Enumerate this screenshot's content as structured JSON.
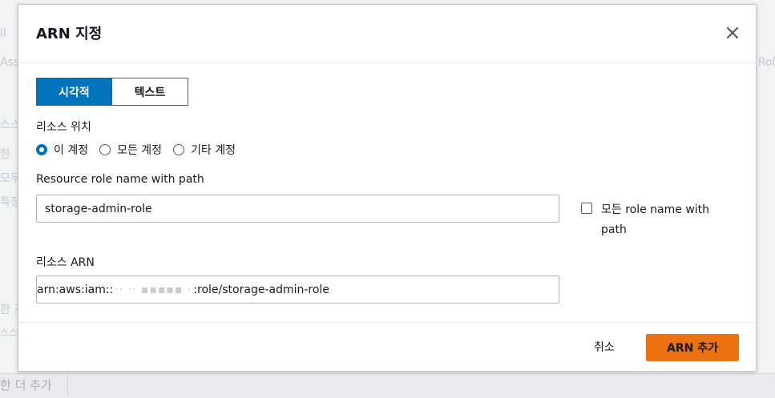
{
  "background": {
    "fragments": [
      "ll",
      "Ass",
      "Rol",
      "스스",
      "한",
      "모두",
      "특정",
      "한 조",
      "스스",
      "한 더 추가"
    ]
  },
  "modal": {
    "title": "ARN 지정",
    "tabs": [
      {
        "label": "시각적",
        "active": true
      },
      {
        "label": "텍스트",
        "active": false
      }
    ],
    "resource_location": {
      "label": "리소스 위치",
      "options": [
        {
          "label": "이 계정",
          "checked": true
        },
        {
          "label": "모든 계정",
          "checked": false
        },
        {
          "label": "기타 계정",
          "checked": false
        }
      ]
    },
    "role_name": {
      "label": "Resource role name with path",
      "value": "storage-admin-role",
      "any_checkbox_label": "모든 role name with path",
      "any_checked": false
    },
    "arn": {
      "label": "리소스 ARN",
      "prefix": "arn:aws:iam::",
      "masked_account": "·· ·· ▪▪▪▪▪ ·",
      "suffix": ":role/storage-admin-role"
    },
    "footer": {
      "cancel_label": "취소",
      "add_label": "ARN 추가"
    }
  },
  "colors": {
    "accent_blue": "#0073bb",
    "primary_orange": "#ec7211"
  }
}
